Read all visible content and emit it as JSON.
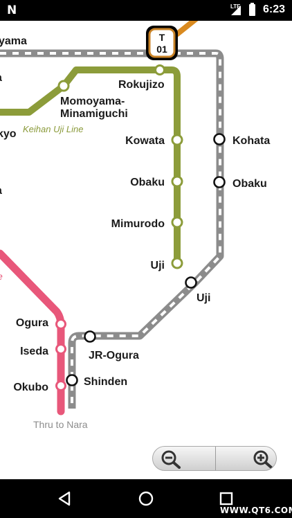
{
  "status_bar": {
    "network": "LTE",
    "time": "6:23",
    "icons": [
      "n-notification-icon",
      "signal-icon",
      "battery-icon"
    ]
  },
  "map": {
    "station_code": {
      "letter": "T",
      "number": "01"
    },
    "colors": {
      "jr_line": "#8c8c8c",
      "keihan_uji_line": "#8c9c3a",
      "kintetsu_line": "#e8577a",
      "station_code_border": "#c88226",
      "orange_line": "#d98a1f"
    },
    "partial_labels_left": [
      "yama",
      "a",
      "kyo",
      "a",
      "e"
    ],
    "line_labels": {
      "keihan_uji": "Keihan Uji Line"
    },
    "keihan_uji_stations": [
      "Rokujizo",
      "Momoyama-",
      "Minamiguchi",
      "Kowata",
      "Obaku",
      "Mimurodo",
      "Uji"
    ],
    "jr_nara_stations": [
      "Kohata",
      "Obaku",
      "Uji",
      "JR-Ogura",
      "Shinden"
    ],
    "kintetsu_stations": [
      "Ogura",
      "Iseda",
      "Okubo"
    ],
    "through_note": "Thru to Nara"
  },
  "zoom": {
    "out_icon": "zoom-out-icon",
    "in_icon": "zoom-in-icon"
  },
  "nav_bar": {
    "icons": [
      "back-icon",
      "home-icon",
      "recents-icon"
    ]
  },
  "watermark": "WWW.QT6.COM"
}
